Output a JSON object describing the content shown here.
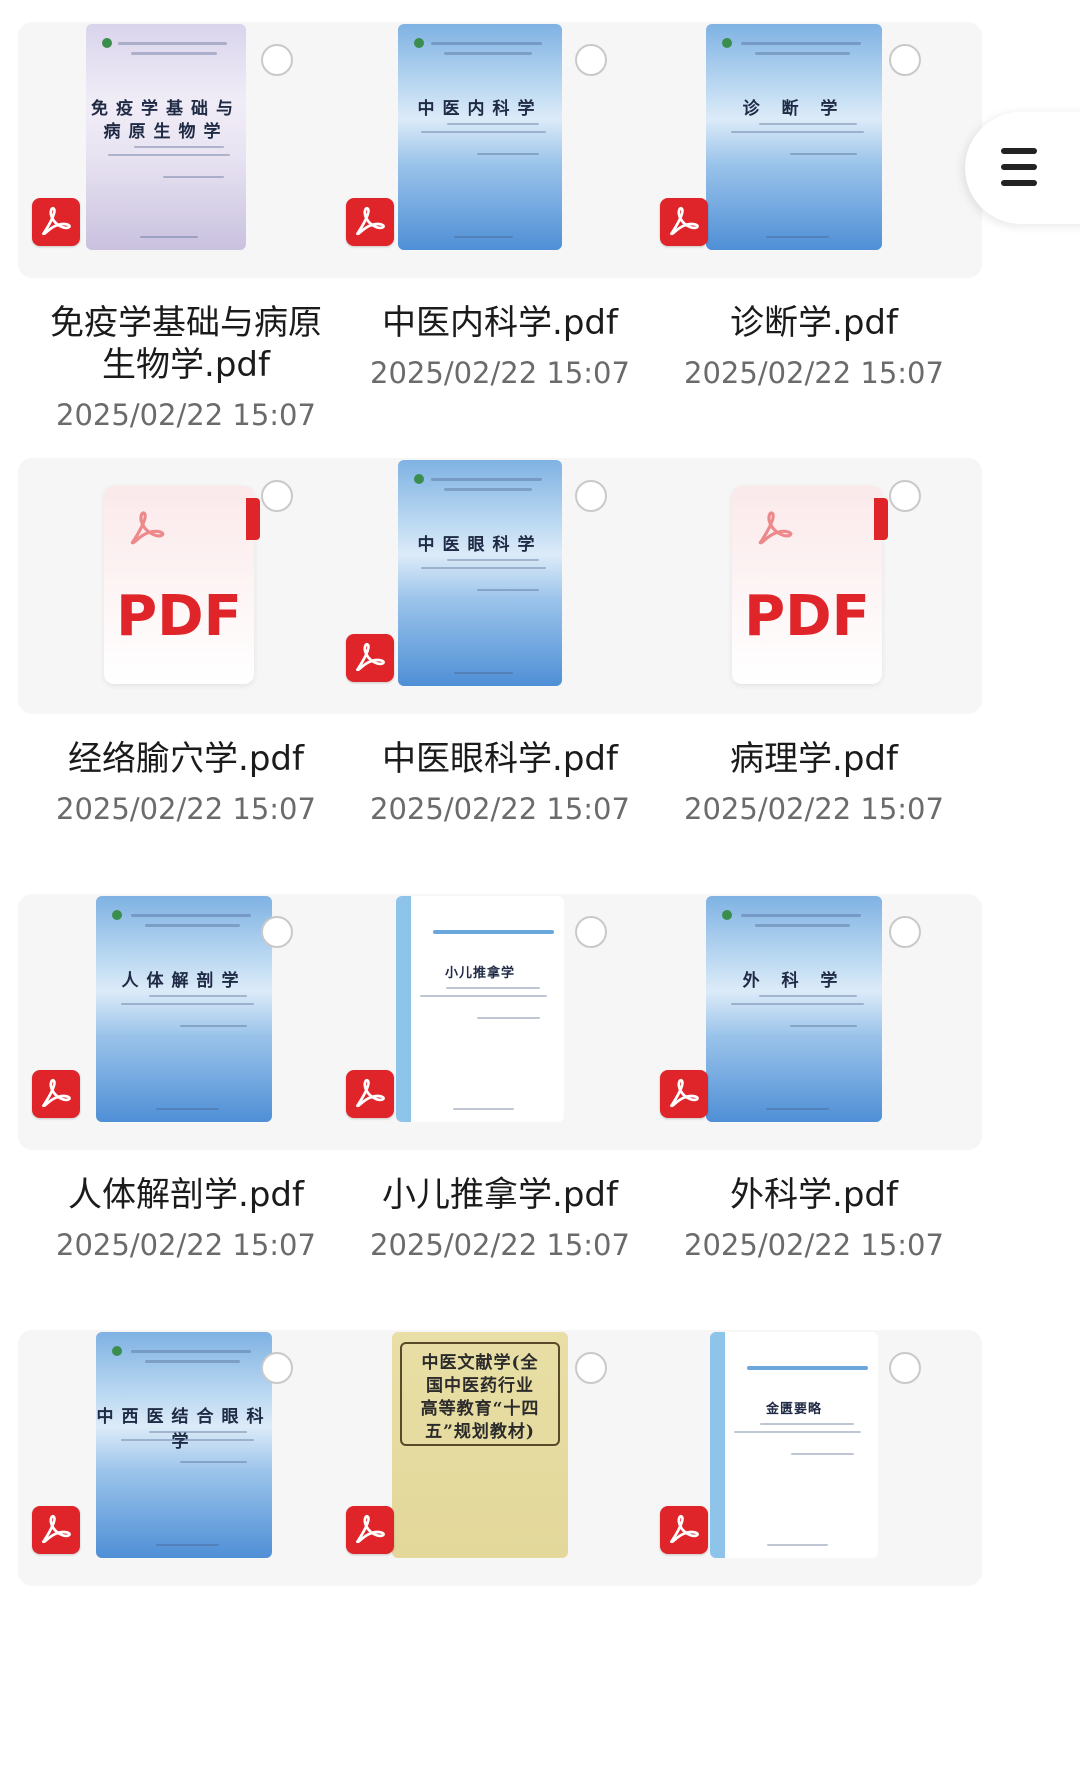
{
  "files": [
    {
      "name": "免疫学基础与病原生物学.pdf",
      "name_lines": [
        "免疫学基础与病原",
        "生物学.pdf"
      ],
      "date": "2025/02/22 15:07",
      "cover_title_lines": [
        "免疫学基础与",
        "病原生物学"
      ],
      "cover": "lilac"
    },
    {
      "name": "中医内科学.pdf",
      "name_lines": [
        "中医内科学.pdf"
      ],
      "date": "2025/02/22 15:07",
      "cover_title_lines": [
        "中医内科学"
      ],
      "cover": "blue"
    },
    {
      "name": "诊断学.pdf",
      "name_lines": [
        "诊断学.pdf"
      ],
      "date": "2025/02/22 15:07",
      "cover_title_lines": [
        "诊 断 学"
      ],
      "cover": "blue"
    },
    {
      "name": "经络腧穴学.pdf",
      "name_lines": [
        "经络腧穴学.pdf"
      ],
      "date": "2025/02/22 15:07",
      "cover": "generic",
      "generic_label": "PDF"
    },
    {
      "name": "中医眼科学.pdf",
      "name_lines": [
        "中医眼科学.pdf"
      ],
      "date": "2025/02/22 15:07",
      "cover_title_lines": [
        "中医眼科学"
      ],
      "cover": "blue"
    },
    {
      "name": "病理学.pdf",
      "name_lines": [
        "病理学.pdf"
      ],
      "date": "2025/02/22 15:07",
      "cover": "generic",
      "generic_label": "PDF"
    },
    {
      "name": "人体解剖学.pdf",
      "name_lines": [
        "人体解剖学.pdf"
      ],
      "date": "2025/02/22 15:07",
      "cover_title_lines": [
        "人体解剖学"
      ],
      "cover": "blue"
    },
    {
      "name": "小儿推拿学.pdf",
      "name_lines": [
        "小儿推拿学.pdf"
      ],
      "date": "2025/02/22 15:07",
      "cover_title_lines": [
        "小儿推拿学"
      ],
      "cover": "white"
    },
    {
      "name": "外科学.pdf",
      "name_lines": [
        "外科学.pdf"
      ],
      "date": "2025/02/22 15:07",
      "cover_title_lines": [
        "外 科 学"
      ],
      "cover": "blue"
    },
    {
      "cover_title_lines": [
        "中西医结合眼科学"
      ],
      "cover": "blue"
    },
    {
      "cover_title_lines": [
        "中医文献学(全",
        "国中医药行业",
        "高等教育“十四",
        "五”规划教材)"
      ],
      "cover": "parchment"
    },
    {
      "cover_title_lines": [
        "金匮要略"
      ],
      "cover": "white"
    }
  ],
  "icons": {
    "pdf_badge": "pdf-acrobat-icon",
    "select": "select-circle-icon",
    "menu": "menu-icon"
  },
  "colors": {
    "pdf_red": "#e0252a",
    "text": "#1b1b1b",
    "date": "#6b6b6b",
    "card_bg": "#f6f6f6"
  }
}
